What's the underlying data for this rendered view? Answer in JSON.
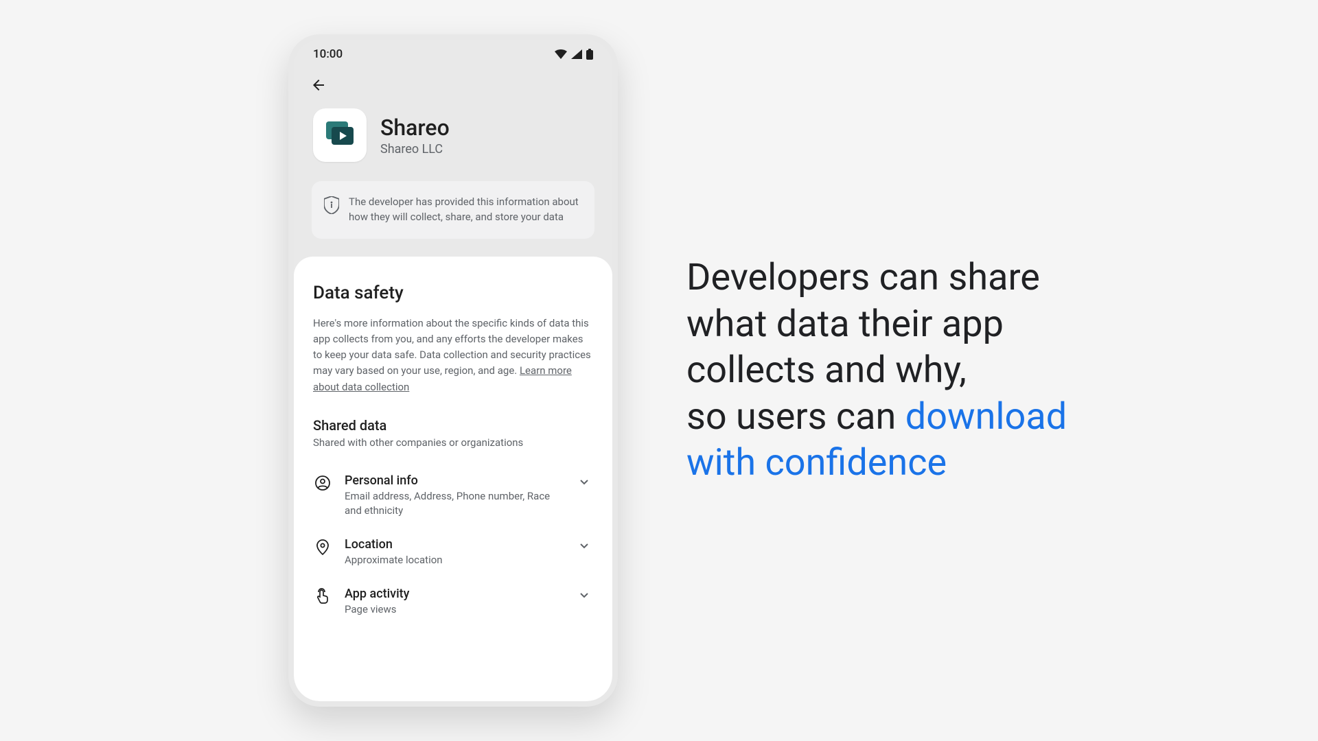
{
  "status": {
    "time": "10:00"
  },
  "app": {
    "name": "Shareo",
    "developer": "Shareo LLC"
  },
  "info_card": {
    "text": "The developer has provided this information about how they will collect, share, and store your data"
  },
  "data_safety": {
    "title": "Data safety",
    "description": "Here's more information about the specific kinds of data this app collects from you, and any efforts the developer makes to keep your data safe. Data collection and security practices may vary based on your use, region, and age. ",
    "learn_more": "Learn more about data collection"
  },
  "shared": {
    "title": "Shared data",
    "subtitle": "Shared with other companies or organizations",
    "items": [
      {
        "icon": "person",
        "title": "Personal info",
        "sub": "Email address, Address, Phone number, Race and ethnicity"
      },
      {
        "icon": "location",
        "title": "Location",
        "sub": "Approximate location"
      },
      {
        "icon": "touch",
        "title": "App activity",
        "sub": "Page views"
      }
    ]
  },
  "headline": {
    "part1": "Developers can share what data their app collects and why,",
    "part2": "so users can ",
    "accent": "download with confidence"
  }
}
